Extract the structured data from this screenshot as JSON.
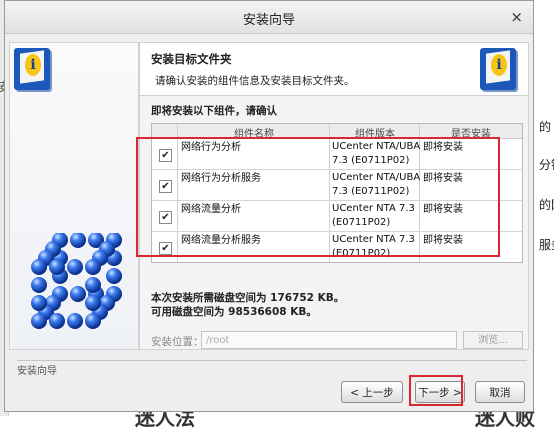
{
  "background": {
    "left_text": "安",
    "right_texts": [
      "的",
      "分钟",
      "的网",
      "服务"
    ],
    "bottom_left": "迷人法",
    "bottom_right": "迷人败"
  },
  "dialog": {
    "title": "安装向导",
    "header_title": "安装目标文件夹",
    "header_subtitle": "请确认安装的组件信息及安装目标文件夹。",
    "confirm_label": "即将安装以下组件，请确认",
    "columns": [
      "组件名称",
      "组件版本",
      "是否安装"
    ],
    "rows": [
      {
        "checked": "✔",
        "name": "网络行为分析",
        "version_line1": "UCenter NTA/UBA",
        "version_line2": "7.3 (E0711P02)",
        "status": "即将安装"
      },
      {
        "checked": "✔",
        "name": "网络行为分析服务",
        "version_line1": "UCenter NTA/UBA",
        "version_line2": "7.3 (E0711P02)",
        "status": "即将安装"
      },
      {
        "checked": "✔",
        "name": "网络流量分析",
        "version_line1": "UCenter NTA 7.3",
        "version_line2": "(E0711P02)",
        "status": "即将安装"
      },
      {
        "checked": "✔",
        "name": "网络流量分析服务",
        "version_line1": "UCenter NTA 7.3",
        "version_line2": "(E0711P02)",
        "status": "即将安装"
      }
    ],
    "space_required": "本次安装所需磁盘空间为 176752 KB。",
    "space_available": "可用磁盘空间为 98536608 KB。",
    "location_label": "安装位置：",
    "location_value": "/root",
    "browse_label": "浏览...",
    "footer_label": "安装向导",
    "prev_label": "< 上一步",
    "next_label": "下一步 >",
    "cancel_label": "取消",
    "close_glyph": "×"
  },
  "colors": {
    "highlight": "#d9282f",
    "icon_blue": "#1b58b9",
    "sphere_blue": "#1f5fd6"
  },
  "icons": [
    "info-book-icon",
    "sphere-cube-logo",
    "close-icon",
    "checkbox-checked-icon"
  ]
}
